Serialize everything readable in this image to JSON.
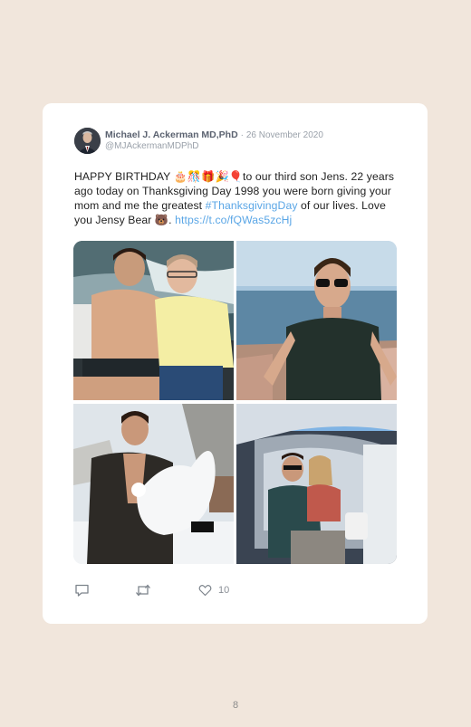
{
  "tweet": {
    "author_name": "Michael J. Ackerman MD,PhD",
    "date_separator": "·",
    "date": "26 November 2020",
    "handle": "@MJAckermanMDPhD",
    "text_part1": "HAPPY BIRTHDAY 🎂🎊🎁🎉🎈to our third son Jens. 22 years ago today on Thanksgiving Day 1998 you were born giving your mom and me the greatest ",
    "hashtag": "#ThanksgivingDay",
    "text_part2": " of our lives. Love you Jensy Bear 🐻. ",
    "link": "https://t.co/fQWas5zcHj",
    "like_count": "10"
  },
  "icons": {
    "reply": "reply-icon",
    "retweet": "retweet-icon",
    "like": "heart-icon"
  },
  "colors": {
    "page_background": "#f1e6dc",
    "card_background": "#ffffff",
    "link": "#5aa6e6",
    "name": "#5b6270",
    "muted": "#9aa1aa"
  },
  "page_number": "8"
}
